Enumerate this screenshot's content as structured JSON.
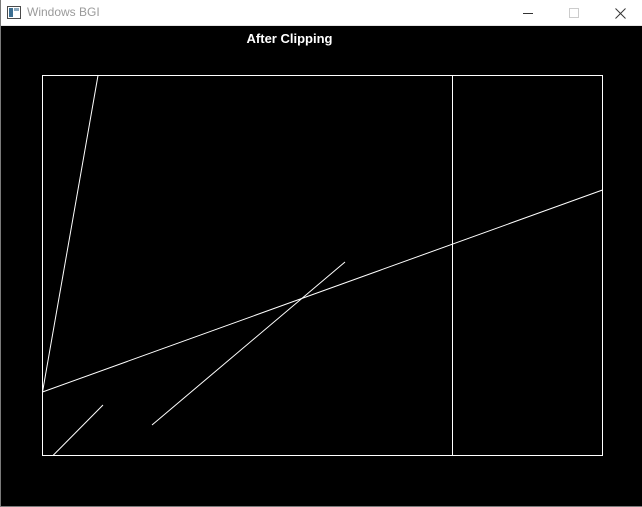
{
  "window": {
    "title": "Windows BGI",
    "controls": {
      "minimize_icon": "minimize-icon",
      "maximize_icon": "maximize-icon",
      "close_icon": "close-icon"
    }
  },
  "canvas": {
    "heading": "After Clipping",
    "background_color": "#000000",
    "stroke_color": "#ffffff"
  }
}
